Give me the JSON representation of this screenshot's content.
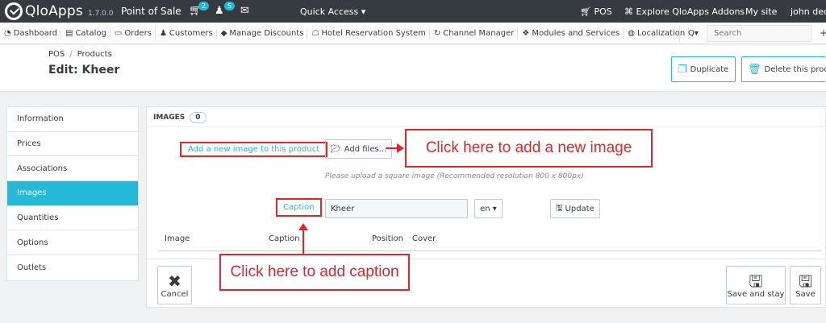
{
  "topbar": {
    "brand": "QloApps",
    "version": "1.7.0.0",
    "shop_name": "Point of Sale",
    "orders_badge": "2",
    "customers_badge": "5",
    "quick_access": "Quick Access ▾",
    "pos": "POS",
    "explore": "Explore QloApps Addons",
    "my_site": "My site",
    "user": "john deo"
  },
  "nav": {
    "items": [
      {
        "label": "Dashboard",
        "icon": "◔"
      },
      {
        "label": "Catalog",
        "icon": "▤"
      },
      {
        "label": "Orders",
        "icon": "▭"
      },
      {
        "label": "Customers",
        "icon": "♟"
      },
      {
        "label": "Manage Discounts",
        "icon": "◆"
      },
      {
        "label": "Hotel Reservation System",
        "icon": "☖"
      },
      {
        "label": "Channel Manager",
        "icon": "↻"
      },
      {
        "label": "Modules and Services",
        "icon": "❖"
      },
      {
        "label": "Localization",
        "icon": "◍"
      }
    ],
    "search_dropdown": "Q▾",
    "search_placeholder": "Search",
    "more": "+"
  },
  "header": {
    "breadcrumb_root": "POS",
    "breadcrumb_sep": "/",
    "breadcrumb_current": "Products",
    "title": "Edit: Kheer",
    "duplicate": "Duplicate",
    "delete": "Delete this product"
  },
  "tabs": [
    {
      "label": "Information",
      "active": false
    },
    {
      "label": "Prices",
      "active": false
    },
    {
      "label": "Associations",
      "active": false
    },
    {
      "label": "Images",
      "active": true
    },
    {
      "label": "Quantities",
      "active": false
    },
    {
      "label": "Options",
      "active": false
    },
    {
      "label": "Outlets",
      "active": false
    }
  ],
  "images_panel": {
    "heading": "IMAGES",
    "count": "0",
    "add_link": "Add a new image to this product",
    "add_files": "Add files...",
    "hint": "Please upload a square image (Recommended resolution 800 x 800px)",
    "caption_label": "Caption",
    "caption_value": "Kheer",
    "lang": "en ▾",
    "update": "Update",
    "columns": [
      "Image",
      "Caption",
      "Position",
      "Cover"
    ],
    "cancel": "Cancel",
    "save_and_stay": "Save and stay",
    "save": "Save"
  },
  "annotations": {
    "add_image": "Click here to add a new image",
    "add_caption": "Click here to add caption"
  },
  "colors": {
    "accent": "#25b9d7",
    "topbar": "#363a41",
    "annotation": "#e0252b"
  }
}
